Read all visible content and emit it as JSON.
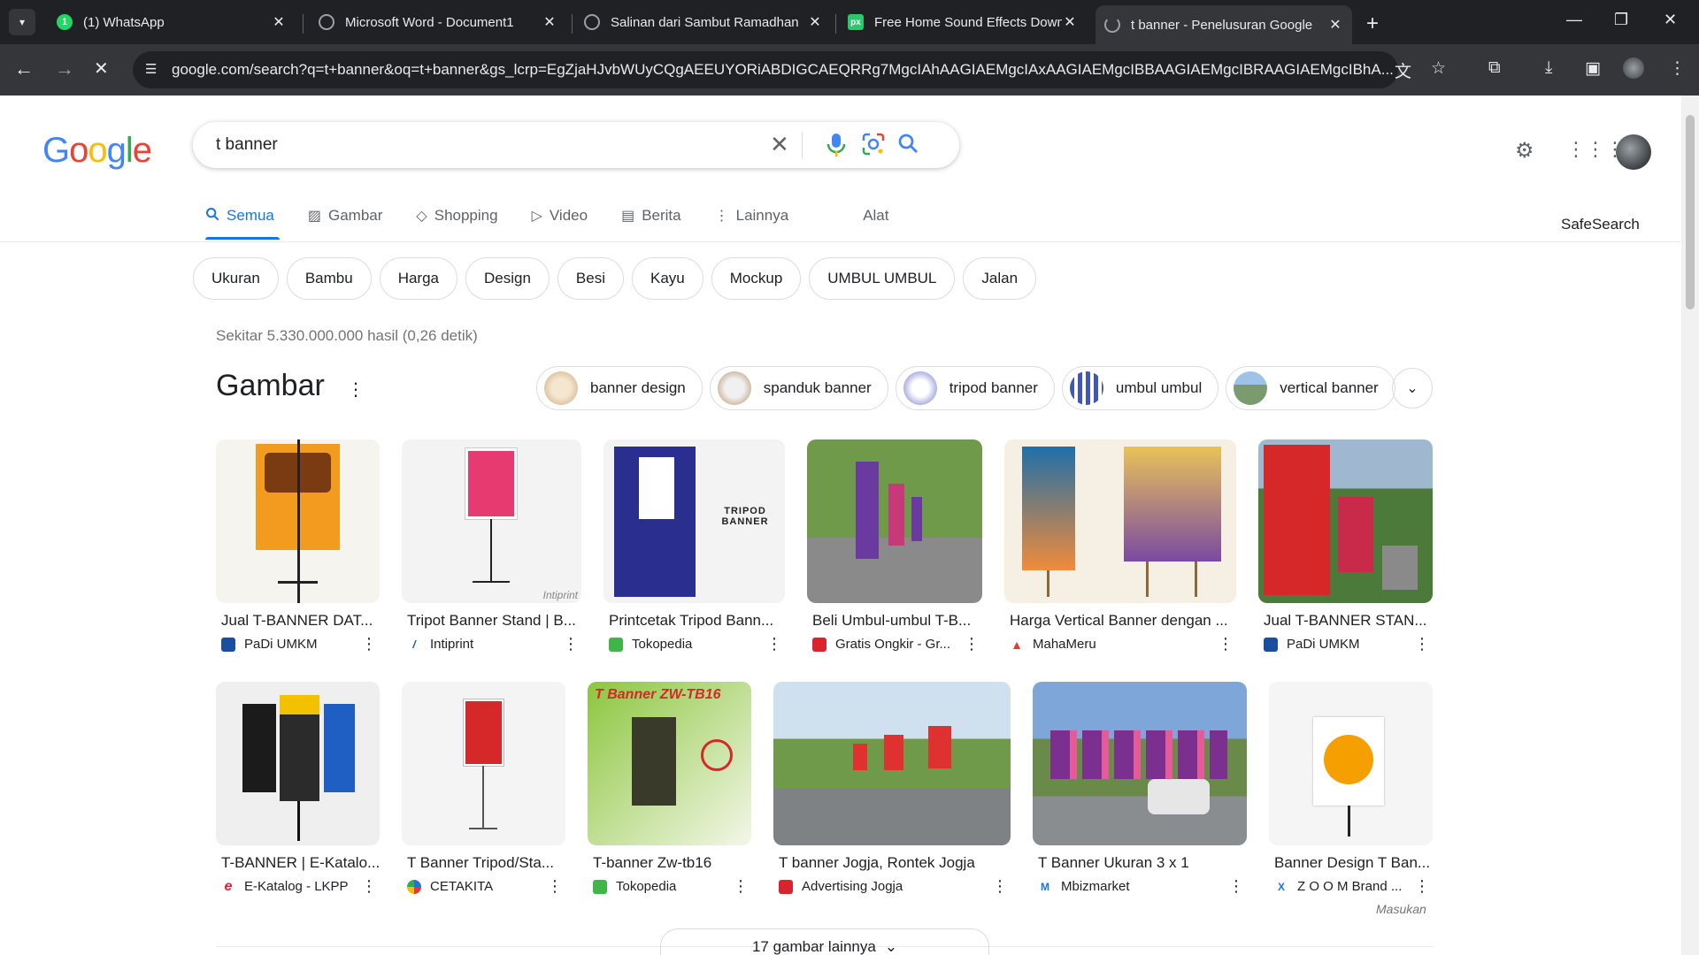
{
  "browser": {
    "tabs": [
      {
        "title": "(1) WhatsApp",
        "favicon": "whatsapp-icon",
        "color": "#25d366"
      },
      {
        "title": "Microsoft Word - Document1",
        "favicon": "globe-icon",
        "color": "#9aa0a6"
      },
      {
        "title": "Salinan dari Sambut Ramadhan",
        "favicon": "globe-icon",
        "color": "#9aa0a6"
      },
      {
        "title": "Free Home Sound Effects Down",
        "favicon": "pixabay-icon",
        "color": "#2ec66d"
      },
      {
        "title": "t banner - Penelusuran Google",
        "favicon": "loading-icon",
        "color": "#9aa0a6"
      }
    ],
    "url": "google.com/search?q=t+banner&oq=t+banner&gs_lcrp=EgZjaHJvbWUyCQgAEEUYORiABDIGCAEQRRg7MgcIAhAAGIAEMgcIAxAAGIAEMgcIBBAAGIAEMgcIBRAAGIAEMgcIBhA..."
  },
  "google": {
    "logo": "Google",
    "query": "t banner",
    "tabs": [
      {
        "label": "Semua",
        "icon": "search-icon"
      },
      {
        "label": "Gambar",
        "icon": "image-icon"
      },
      {
        "label": "Shopping",
        "icon": "tag-icon"
      },
      {
        "label": "Video",
        "icon": "play-icon"
      },
      {
        "label": "Berita",
        "icon": "news-icon"
      },
      {
        "label": "Lainnya",
        "icon": "more-vert-icon"
      },
      {
        "label": "Alat",
        "icon": ""
      }
    ],
    "safesearch": "SafeSearch",
    "chips": [
      "Ukuran",
      "Bambu",
      "Harga",
      "Design",
      "Besi",
      "Kayu",
      "Mockup",
      "UMBUL UMBUL",
      "Jalan"
    ],
    "result_stats": "Sekitar 5.330.000.000 hasil (0,26 detik)",
    "images_heading": "Gambar",
    "related": [
      {
        "label": "banner design",
        "color": "#e8c9a0"
      },
      {
        "label": "spanduk banner",
        "color": "#c9a77c"
      },
      {
        "label": "tripod banner",
        "color": "#6a6fc9"
      },
      {
        "label": "umbul umbul",
        "color": "#3f57b5"
      },
      {
        "label": "vertical banner",
        "color": "#7a9b6e"
      }
    ],
    "images_row1": [
      {
        "title": "Jual T-BANNER DAT...",
        "source": "PaDi UMKM",
        "src_icon_color": "#1a4fa0",
        "bg": "#f2e3c7",
        "accent": "#f29b1f"
      },
      {
        "title": "Tripot Banner Stand | B...",
        "source": "Intiprint",
        "src_icon_color": "#1a4fa0",
        "bg": "#f3f3f3",
        "accent": "#e63a70"
      },
      {
        "title": "Printcetak Tripod Bann...",
        "source": "Tokopedia",
        "src_icon_color": "#42b549",
        "bg": "#e9eaf2",
        "accent": "#2a2f8f"
      },
      {
        "title": "Beli Umbul-umbul T-B...",
        "source": "Gratis Ongkir - Gr...",
        "src_icon_color": "#d9232d",
        "bg": "#5f8b3a",
        "accent": "#6a3aa0"
      },
      {
        "title": "Harga Vertical Banner dengan ...",
        "source": "MahaMeru",
        "src_icon_color": "#e53935",
        "bg": "#f5efe4",
        "accent": "#1f6fa8"
      },
      {
        "title": "Jual T-BANNER STAN...",
        "source": "PaDi UMKM",
        "src_icon_color": "#1a4fa0",
        "bg": "#4b7a3a",
        "accent": "#d62828"
      }
    ],
    "images_row2": [
      {
        "title": "T-BANNER | E-Katalo...",
        "source": "E-Katalog - LKPP",
        "src_icon_color": "#d9232d",
        "bg": "#efefef",
        "accent": "#1b1b1b"
      },
      {
        "title": "T Banner Tripod/Sta...",
        "source": "CETAKITA",
        "src_icon_color": "#2b6cd6",
        "bg": "#f4f4f4",
        "accent": "#d62828"
      },
      {
        "title": "T-banner Zw-tb16",
        "source": "Tokopedia",
        "src_icon_color": "#42b549",
        "bg": "#8cc63f",
        "accent": "#d62828"
      },
      {
        "title": "T banner Jogja, Rontek Jogja",
        "source": "Advertising Jogja",
        "src_icon_color": "#d9232d",
        "bg": "#6f9a4a",
        "accent": "#e03131"
      },
      {
        "title": "T Banner Ukuran 3 x 1",
        "source": "Mbizmarket",
        "src_icon_color": "#1a73e8",
        "bg": "#6f8fc4",
        "accent": "#7b2f8f"
      },
      {
        "title": "Banner Design T Ban...",
        "source": "Z O O M Brand ...",
        "src_icon_color": "#1a73e8",
        "bg": "#f5f5f5",
        "accent": "#f59f00"
      }
    ],
    "feedback": "Masukan",
    "more_images": "17 gambar lainnya"
  }
}
